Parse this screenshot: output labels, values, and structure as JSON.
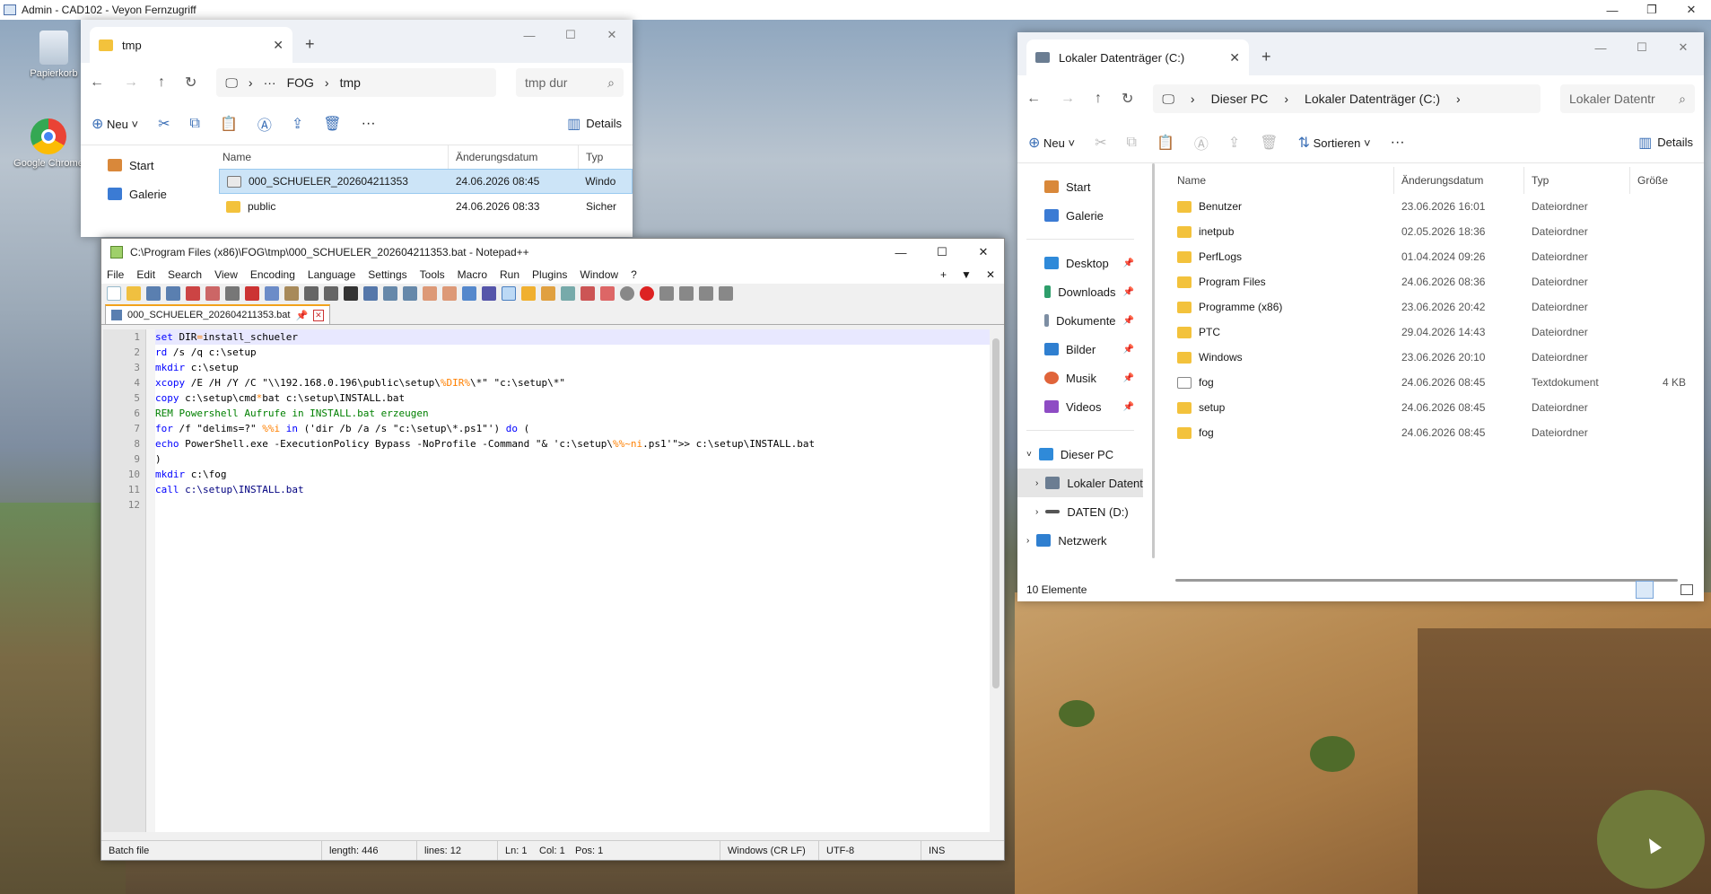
{
  "rdp": {
    "title": "Admin - CAD102 - Veyon Fernzugriff"
  },
  "desktop": {
    "icons": [
      {
        "label": "Papierkorb"
      },
      {
        "label": "Google Chrome"
      }
    ]
  },
  "explorer_tmp": {
    "tab_title": "tmp",
    "breadcrumb": [
      "FOG",
      "tmp"
    ],
    "search_placeholder": "tmp dur",
    "new_label": "Neu",
    "details_label": "Details",
    "nav": [
      "Start",
      "Galerie"
    ],
    "columns": [
      "Name",
      "Änderungsdatum",
      "Typ"
    ],
    "rows": [
      {
        "name": "000_SCHUELER_202604211353",
        "date": "24.06.2026 08:45",
        "type": "Windo",
        "icon": "bat"
      },
      {
        "name": "public",
        "date": "24.06.2026 08:33",
        "type": "Sicher",
        "icon": "shortcut"
      }
    ]
  },
  "explorer_c": {
    "tab_title": "Lokaler Datenträger (C:)",
    "breadcrumb": [
      "Dieser PC",
      "Lokaler Datenträger (C:)"
    ],
    "search_placeholder": "Lokaler Datentr",
    "new_label": "Neu",
    "sort_label": "Sortieren",
    "details_label": "Details",
    "nav": [
      {
        "label": "Start",
        "pin": false
      },
      {
        "label": "Galerie",
        "pin": false
      },
      {
        "label": "Desktop",
        "pin": true
      },
      {
        "label": "Downloads",
        "pin": true
      },
      {
        "label": "Dokumente",
        "pin": true
      },
      {
        "label": "Bilder",
        "pin": true
      },
      {
        "label": "Musik",
        "pin": true
      },
      {
        "label": "Videos",
        "pin": true
      }
    ],
    "tree": [
      "Dieser PC",
      "Lokaler Datent",
      "DATEN (D:)",
      "Netzwerk"
    ],
    "columns": [
      "Name",
      "Änderungsdatum",
      "Typ",
      "Größe"
    ],
    "rows": [
      {
        "name": "Benutzer",
        "date": "23.06.2026 16:01",
        "type": "Dateiordner",
        "size": "",
        "icon": "folder"
      },
      {
        "name": "inetpub",
        "date": "02.05.2026 18:36",
        "type": "Dateiordner",
        "size": "",
        "icon": "folder"
      },
      {
        "name": "PerfLogs",
        "date": "01.04.2024 09:26",
        "type": "Dateiordner",
        "size": "",
        "icon": "folder"
      },
      {
        "name": "Program Files",
        "date": "24.06.2026 08:36",
        "type": "Dateiordner",
        "size": "",
        "icon": "folder"
      },
      {
        "name": "Programme (x86)",
        "date": "23.06.2026 20:42",
        "type": "Dateiordner",
        "size": "",
        "icon": "folder"
      },
      {
        "name": "PTC",
        "date": "29.04.2026 14:43",
        "type": "Dateiordner",
        "size": "",
        "icon": "folder"
      },
      {
        "name": "Windows",
        "date": "23.06.2026 20:10",
        "type": "Dateiordner",
        "size": "",
        "icon": "folder"
      },
      {
        "name": "fog",
        "date": "24.06.2026 08:45",
        "type": "Textdokument",
        "size": "4 KB",
        "icon": "doc"
      },
      {
        "name": "setup",
        "date": "24.06.2026 08:45",
        "type": "Dateiordner",
        "size": "",
        "icon": "folder"
      },
      {
        "name": "fog",
        "date": "24.06.2026 08:45",
        "type": "Dateiordner",
        "size": "",
        "icon": "folder"
      }
    ],
    "status": "10 Elemente"
  },
  "notepad": {
    "title": "C:\\Program Files (x86)\\FOG\\tmp\\000_SCHUELER_202604211353.bat - Notepad++",
    "menu": [
      "File",
      "Edit",
      "Search",
      "View",
      "Encoding",
      "Language",
      "Settings",
      "Tools",
      "Macro",
      "Run",
      "Plugins",
      "Window",
      "?"
    ],
    "tab": "000_SCHUELER_202604211353.bat",
    "lines": [
      "1",
      "2",
      "3",
      "4",
      "5",
      "6",
      "7",
      "8",
      "9",
      "10",
      "11",
      "12"
    ],
    "status": {
      "type": "Batch file",
      "length": "length: 446",
      "lines": "lines: 12",
      "ln": "Ln: 1",
      "col": "Col: 1",
      "pos": "Pos: 1",
      "eol": "Windows (CR LF)",
      "enc": "UTF-8",
      "mode": "INS"
    },
    "code": [
      [
        {
          "t": "set",
          "c": "kw"
        },
        {
          "t": " DIR"
        },
        {
          "t": "=",
          "c": "var"
        },
        {
          "t": "install_schueler"
        }
      ],
      [
        {
          "t": "rd",
          "c": "kw"
        },
        {
          "t": " /s /q c:\\setup"
        }
      ],
      [
        {
          "t": "mkdir",
          "c": "kw"
        },
        {
          "t": " c:\\setup"
        }
      ],
      [
        {
          "t": "xcopy",
          "c": "kw"
        },
        {
          "t": " /E /H /Y /C \"\\\\192.168.0.196\\public\\setup\\"
        },
        {
          "t": "%DIR%",
          "c": "var"
        },
        {
          "t": "\\*\" \"c:\\setup\\*\""
        }
      ],
      [
        {
          "t": "copy",
          "c": "kw"
        },
        {
          "t": " c:\\setup\\cmd"
        },
        {
          "t": "*",
          "c": "var"
        },
        {
          "t": "bat c:\\setup\\INSTALL.bat"
        }
      ],
      [
        {
          "t": "REM Powershell Aufrufe in INSTALL.bat erzeugen",
          "c": "rm"
        }
      ],
      [
        {
          "t": "for",
          "c": "kw"
        },
        {
          "t": " /f \"delims=?\" "
        },
        {
          "t": "%%i",
          "c": "var"
        },
        {
          "t": " "
        },
        {
          "t": "in",
          "c": "kw"
        },
        {
          "t": " ('dir /b /a /s \"c:\\setup\\*.ps1\"') "
        },
        {
          "t": "do",
          "c": "kw"
        },
        {
          "t": " ("
        }
      ],
      [
        {
          "t": "echo",
          "c": "kw"
        },
        {
          "t": " PowerShell.exe -ExecutionPolicy Bypass -NoProfile -Command \"& 'c:\\setup\\"
        },
        {
          "t": "%%~ni",
          "c": "var"
        },
        {
          "t": ".ps1'\">> c:\\setup\\INSTALL.bat"
        }
      ],
      [
        {
          "t": ")"
        }
      ],
      [
        {
          "t": "mkdir",
          "c": "kw"
        },
        {
          "t": " c:\\fog"
        }
      ],
      [
        {
          "t": "call",
          "c": "kw"
        },
        {
          "t": " c:\\setup\\INSTALL.bat",
          "c": "str"
        }
      ],
      []
    ]
  }
}
